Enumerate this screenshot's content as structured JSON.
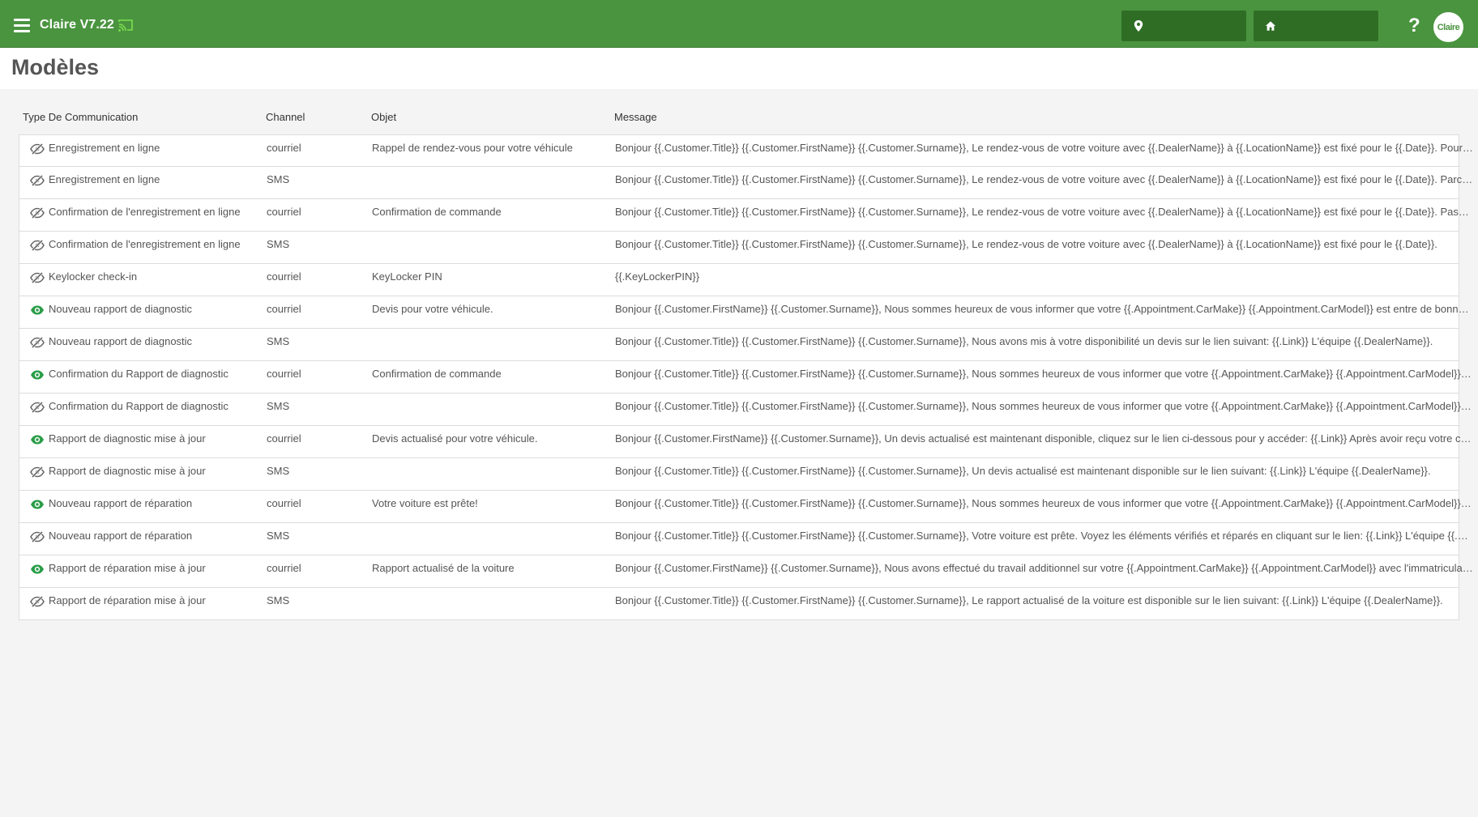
{
  "header": {
    "app_title": "Claire V7.22",
    "help_label": "?",
    "avatar_label": "Claire",
    "location_value": "",
    "dealer_value": ""
  },
  "page": {
    "title": "Modèles"
  },
  "table": {
    "columns": {
      "type": "Type De Communication",
      "channel": "Channel",
      "object": "Objet",
      "message": "Message"
    },
    "rows": [
      {
        "visible": false,
        "type": "Enregistrement en ligne",
        "channel": "courriel",
        "object": "Rappel de rendez-vous pour votre véhicule",
        "message": "Bonjour {{.Customer.Title}} {{.Customer.FirstName}} {{.Customer.Surname}}, Le rendez-vous de votre voiture avec {{.DealerName}} à {{.LocationName}} est fixé pour le {{.Date}}. Pour plus de ..."
      },
      {
        "visible": false,
        "type": "Enregistrement en ligne",
        "channel": "SMS",
        "object": "",
        "message": "Bonjour {{.Customer.Title}} {{.Customer.FirstName}} {{.Customer.Surname}}, Le rendez-vous de votre voiture avec {{.DealerName}} à {{.LocationName}} est fixé pour le {{.Date}}. Parcourez les..."
      },
      {
        "visible": false,
        "type": "Confirmation de l'enregistrement en ligne",
        "channel": "courriel",
        "object": "Confirmation de commande",
        "message": "Bonjour {{.Customer.Title}} {{.Customer.FirstName}} {{.Customer.Surname}}, Le rendez-vous de votre voiture avec {{.DealerName}} à {{.LocationName}} est fixé pour le {{.Date}}. Passez en re..."
      },
      {
        "visible": false,
        "type": "Confirmation de l'enregistrement en ligne",
        "channel": "SMS",
        "object": "",
        "message": "Bonjour {{.Customer.Title}} {{.Customer.FirstName}} {{.Customer.Surname}}, Le rendez-vous de votre voiture avec {{.DealerName}} à {{.LocationName}} est fixé pour le {{.Date}}."
      },
      {
        "visible": false,
        "type": "Keylocker check-in",
        "channel": "courriel",
        "object": "KeyLocker PIN",
        "message": "{{.KeyLockerPIN}}"
      },
      {
        "visible": true,
        "type": "Nouveau rapport de diagnostic",
        "channel": "courriel",
        "object": "Devis pour votre véhicule.",
        "message": "Bonjour {{.Customer.FirstName}} {{.Customer.Surname}}, Nous sommes heureux de vous informer que votre {{.Appointment.CarMake}} {{.Appointment.CarModel}} est entre de bonnes mai..."
      },
      {
        "visible": false,
        "type": "Nouveau rapport de diagnostic",
        "channel": "SMS",
        "object": "",
        "message": "Bonjour {{.Customer.Title}} {{.Customer.FirstName}} {{.Customer.Surname}}, Nous avons mis à votre disponibilité un devis sur le lien suivant: {{.Link}} L'équipe {{.DealerName}}."
      },
      {
        "visible": true,
        "type": "Confirmation du Rapport de diagnostic",
        "channel": "courriel",
        "object": "Confirmation de commande",
        "message": "Bonjour {{.Customer.Title}} {{.Customer.FirstName}} {{.Customer.Surname}}, Nous sommes heureux de vous informer que votre {{.Appointment.CarMake}} {{.Appointment.CarModel}} est en..."
      },
      {
        "visible": false,
        "type": "Confirmation du Rapport de diagnostic",
        "channel": "SMS",
        "object": "",
        "message": "Bonjour {{.Customer.Title}} {{.Customer.FirstName}} {{.Customer.Surname}}, Nous sommes heureux de vous informer que votre {{.Appointment.CarMake}} {{.Appointment.CarModel}} est en..."
      },
      {
        "visible": true,
        "type": "Rapport de diagnostic mise à jour",
        "channel": "courriel",
        "object": "Devis actualisé pour votre véhicule.",
        "message": "Bonjour {{.Customer.FirstName}} {{.Customer.Surname}}, Un devis actualisé est maintenant disponible, cliquez sur le lien ci-dessous pour y accéder: {{.Link}} Après avoir reçu votre confirma..."
      },
      {
        "visible": false,
        "type": "Rapport de diagnostic mise à jour",
        "channel": "SMS",
        "object": "",
        "message": "Bonjour {{.Customer.Title}} {{.Customer.FirstName}} {{.Customer.Surname}}, Un devis actualisé est maintenant disponible sur le lien suivant: {{.Link}} L'équipe {{.DealerName}}."
      },
      {
        "visible": true,
        "type": "Nouveau rapport de réparation",
        "channel": "courriel",
        "object": "Votre voiture est prête!",
        "message": "Bonjour {{.Customer.Title}} {{.Customer.FirstName}} {{.Customer.Surname}}, Nous sommes heureux de vous informer que votre {{.Appointment.CarMake}} {{.Appointment.CarModel}} avec e..."
      },
      {
        "visible": false,
        "type": "Nouveau rapport de réparation",
        "channel": "SMS",
        "object": "",
        "message": "Bonjour {{.Customer.Title}} {{.Customer.FirstName}} {{.Customer.Surname}}, Votre voiture est prête. Voyez les éléments vérifiés et réparés en cliquant sur le lien: {{.Link}} L'équipe {{.DealerN..."
      },
      {
        "visible": true,
        "type": "Rapport de réparation mise à jour",
        "channel": "courriel",
        "object": "Rapport actualisé de la voiture",
        "message": "Bonjour {{.Customer.FirstName}} {{.Customer.Surname}}, Nous avons effectué du travail additionnel sur votre {{.Appointment.CarMake}} {{.Appointment.CarModel}} avec l'immatriculation {..."
      },
      {
        "visible": false,
        "type": "Rapport de réparation mise à jour",
        "channel": "SMS",
        "object": "",
        "message": "Bonjour {{.Customer.Title}} {{.Customer.FirstName}} {{.Customer.Surname}}, Le rapport actualisé de la voiture est disponible sur le lien suivant: {{.Link}} L'équipe {{.DealerName}}."
      }
    ]
  },
  "colors": {
    "topbar": "#4a943f",
    "selector_bg": "#2f6d24",
    "eye_visible": "#2a9d48",
    "eye_hidden": "#666666",
    "cast_icon": "#7ee04f"
  },
  "icons": {
    "menu": "hamburger-icon",
    "cast": "cast-icon",
    "location": "map-marker-icon",
    "dealer": "home-icon",
    "help": "question-mark-icon",
    "row_visible": "eye-icon",
    "row_hidden": "eye-slash-icon"
  }
}
